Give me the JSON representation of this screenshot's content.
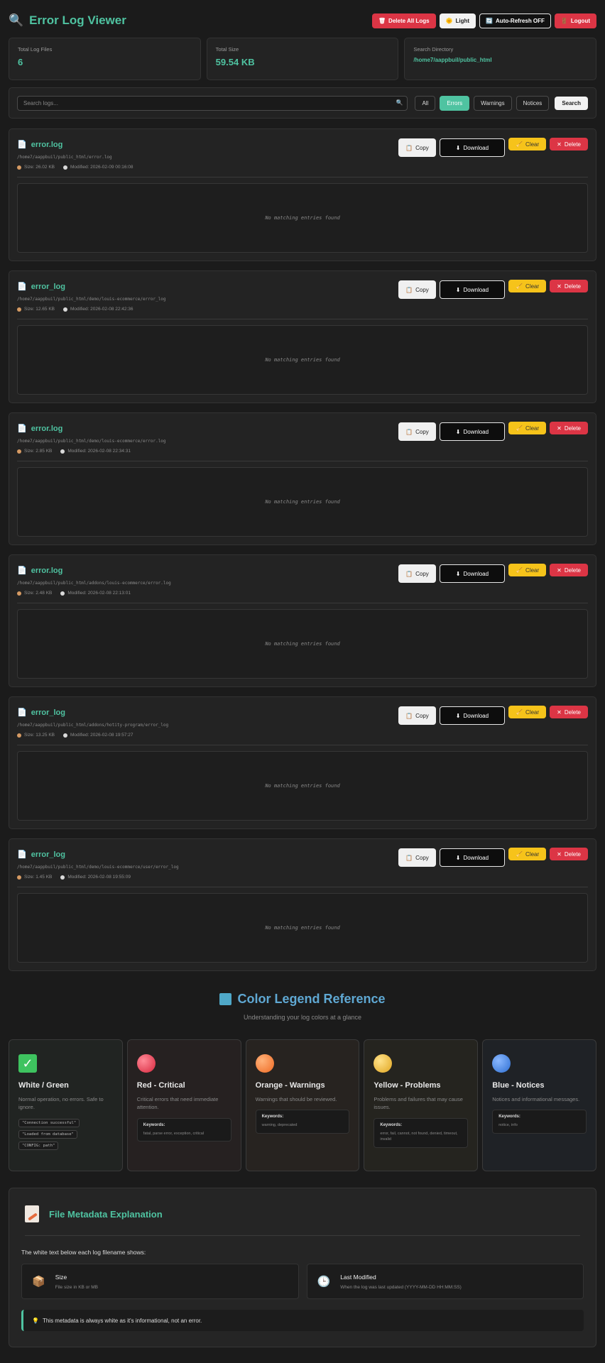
{
  "header": {
    "title": "Error Log Viewer",
    "title_icon": "search-icon",
    "delete_all_label": "Delete All Logs",
    "light_label": "Light",
    "auto_refresh_label": "Auto-Refresh OFF",
    "logout_label": "Logout"
  },
  "stats": {
    "total_files_label": "Total Log Files",
    "total_files_value": "6",
    "total_size_label": "Total Size",
    "total_size_value": "59.54 KB",
    "directory_label": "Search Directory",
    "directory_value": "/home7/aappbuil/public_html"
  },
  "search": {
    "placeholder": "Search logs...",
    "value": "",
    "filters": [
      "All",
      "Errors",
      "Warnings",
      "Notices"
    ],
    "active_filter": "Errors",
    "search_button": "Search"
  },
  "card_actions": {
    "copy": "Copy",
    "download": "Download",
    "clear": "Clear",
    "delete": "Delete"
  },
  "logs": [
    {
      "name": "error.log",
      "path": "/home7/aappbuil/public_html/error.log",
      "size": "Size: 26.02 KB",
      "modified": "Modified: 2026-02-09 00:16:08",
      "empty_text": "No matching entries found"
    },
    {
      "name": "error_log",
      "path": "/home7/aappbuil/public_html/demo/louis-ecommerce/error_log",
      "size": "Size: 12.65 KB",
      "modified": "Modified: 2026-02-08 22:42:36",
      "empty_text": "No matching entries found"
    },
    {
      "name": "error.log",
      "path": "/home7/aappbuil/public_html/demo/louis-ecommerce/error.log",
      "size": "Size: 2.85 KB",
      "modified": "Modified: 2026-02-08 22:34:31",
      "empty_text": "No matching entries found"
    },
    {
      "name": "error.log",
      "path": "/home7/aappbuil/public_html/addons/louis-ecommerce/error.log",
      "size": "Size: 2.48 KB",
      "modified": "Modified: 2026-02-08 22:13:01",
      "empty_text": "No matching entries found"
    },
    {
      "name": "error_log",
      "path": "/home7/aappbuil/public_html/addons/hotity-program/error_log",
      "size": "Size: 13.25 KB",
      "modified": "Modified: 2026-02-08 19:57:27",
      "empty_text": "No matching entries found"
    },
    {
      "name": "error_log",
      "path": "/home7/aappbuil/public_html/demo/louis-ecommerce/user/error_log",
      "size": "Size: 1.45 KB",
      "modified": "Modified: 2026-02-08 19:55:09",
      "empty_text": "No matching entries found"
    }
  ],
  "legend": {
    "title": "Color Legend Reference",
    "subtitle": "Understanding your log colors at a glance",
    "cards": [
      {
        "title": "White / Green",
        "desc": "Normal operation, no errors. Safe to ignore.",
        "examples": [
          "\"Connection successful\"",
          "\"Loaded from database\"",
          "\"CONFIG: path\""
        ]
      },
      {
        "title": "Red - Critical",
        "desc": "Critical errors that need immediate attention.",
        "kw_label": "Keywords:",
        "keywords": "fatal, parse error, exception, critical"
      },
      {
        "title": "Orange - Warnings",
        "desc": "Warnings that should be reviewed.",
        "kw_label": "Keywords:",
        "keywords": "warning, deprecated"
      },
      {
        "title": "Yellow - Problems",
        "desc": "Problems and failures that may cause issues.",
        "kw_label": "Keywords:",
        "keywords": "error, fail, cannot, not found, denied, timeout, invalid"
      },
      {
        "title": "Blue - Notices",
        "desc": "Notices and informational messages.",
        "kw_label": "Keywords:",
        "keywords": "notice, info"
      }
    ]
  },
  "metadata": {
    "title": "File Metadata Explanation",
    "intro": "The white text below each log filename shows:",
    "size_title": "Size",
    "size_desc": "File size in KB or MB",
    "modified_title": "Last Modified",
    "modified_desc": "When the log was last updated (YYYY-MM-DD HH:MM:SS)",
    "note": "This metadata is always white as it's informational, not an error."
  },
  "colors": {
    "accent": "#4fc3a1",
    "danger": "#dc3545",
    "warning": "#f6c31a",
    "legend_title": "#5fa8d3"
  }
}
